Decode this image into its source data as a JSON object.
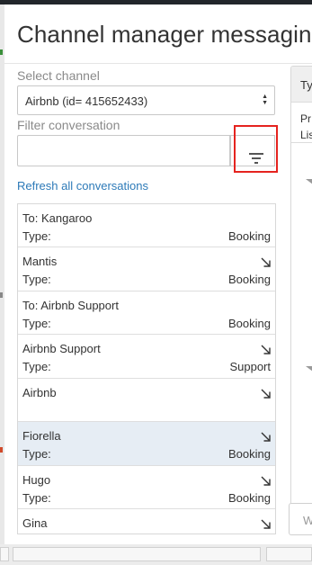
{
  "dialog": {
    "title": "Channel manager messaging"
  },
  "channel": {
    "label": "Select channel",
    "selected": "Airbnb (id= 415652433)"
  },
  "filter": {
    "label": "Filter conversation",
    "value": "",
    "placeholder": "",
    "search_icon": "search-icon",
    "filter_icon": "filter-lines-icon"
  },
  "refresh_label": "Refresh all conversations",
  "type_label": "Type:",
  "conversations": [
    {
      "name": "To:  Kangaroo",
      "type": "Booking",
      "selected": false,
      "arrow": false
    },
    {
      "name": "Mantis",
      "type": "Booking",
      "selected": false,
      "arrow": true
    },
    {
      "name": "To: Airbnb Support",
      "type": "Booking",
      "selected": false,
      "arrow": false
    },
    {
      "name": "Airbnb Support",
      "type": "Support",
      "selected": false,
      "arrow": true
    },
    {
      "name": "Airbnb",
      "type": "",
      "selected": false,
      "arrow": true
    },
    {
      "name": "Fiorella",
      "type": "Booking",
      "selected": true,
      "arrow": true
    },
    {
      "name": "Hugo",
      "type": "Booking",
      "selected": false,
      "arrow": true
    },
    {
      "name": "Gina",
      "type": "",
      "selected": false,
      "arrow": true
    }
  ],
  "detail": {
    "header": "Typ",
    "line1": "Pr",
    "line2": "Lis"
  },
  "reply_placeholder": "Wr",
  "colors": {
    "highlight": "#e5231f",
    "link": "#2d7ab8",
    "selected_row": "#e6edf4"
  }
}
